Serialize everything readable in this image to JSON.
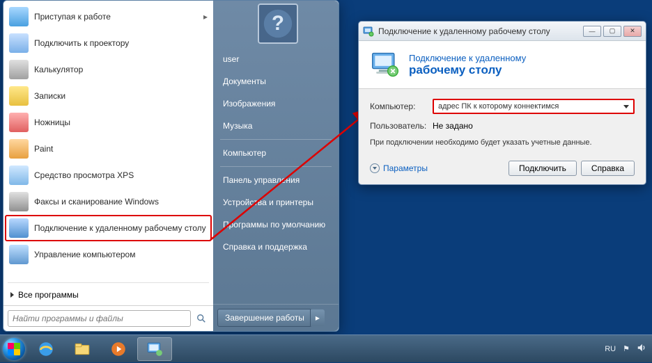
{
  "start_menu": {
    "programs": [
      {
        "label": "Приступая к работе",
        "icon": "getting-started-icon",
        "cls": "ic-get",
        "arrow": true
      },
      {
        "label": "Подключить к проектору",
        "icon": "projector-icon",
        "cls": "ic-proj"
      },
      {
        "label": "Калькулятор",
        "icon": "calculator-icon",
        "cls": "ic-calc"
      },
      {
        "label": "Записки",
        "icon": "sticky-notes-icon",
        "cls": "ic-note"
      },
      {
        "label": "Ножницы",
        "icon": "snipping-tool-icon",
        "cls": "ic-snip"
      },
      {
        "label": "Paint",
        "icon": "paint-icon",
        "cls": "ic-paint"
      },
      {
        "label": "Средство просмотра XPS",
        "icon": "xps-viewer-icon",
        "cls": "ic-xps"
      },
      {
        "label": "Факсы и сканирование Windows",
        "icon": "fax-scan-icon",
        "cls": "ic-fax"
      },
      {
        "label": "Подключение к удаленному рабочему столу",
        "icon": "rdp-icon",
        "cls": "ic-rdp",
        "highlighted": true
      },
      {
        "label": "Управление компьютером",
        "icon": "computer-mgmt-icon",
        "cls": "ic-mgmt"
      }
    ],
    "all_programs": "Все программы",
    "search_placeholder": "Найти программы и файлы",
    "right_items_top": [
      "user",
      "Документы",
      "Изображения",
      "Музыка"
    ],
    "right_items_mid": [
      "Компьютер"
    ],
    "right_items_bot": [
      "Панель управления",
      "Устройства и принтеры",
      "Программы по умолчанию",
      "Справка и поддержка"
    ],
    "shutdown": "Завершение работы"
  },
  "rdp": {
    "title": "Подключение к удаленному рабочему столу",
    "header_l1": "Подключение к удаленному",
    "header_l2": "рабочему столу",
    "computer_label": "Компьютер:",
    "computer_value": "адрес ПК к которому коннектимся",
    "user_label": "Пользователь:",
    "user_value": "Не задано",
    "info": "При подключении необходимо будет указать учетные данные.",
    "options": "Параметры",
    "connect": "Подключить",
    "help": "Справка"
  },
  "tray": {
    "lang": "RU"
  }
}
